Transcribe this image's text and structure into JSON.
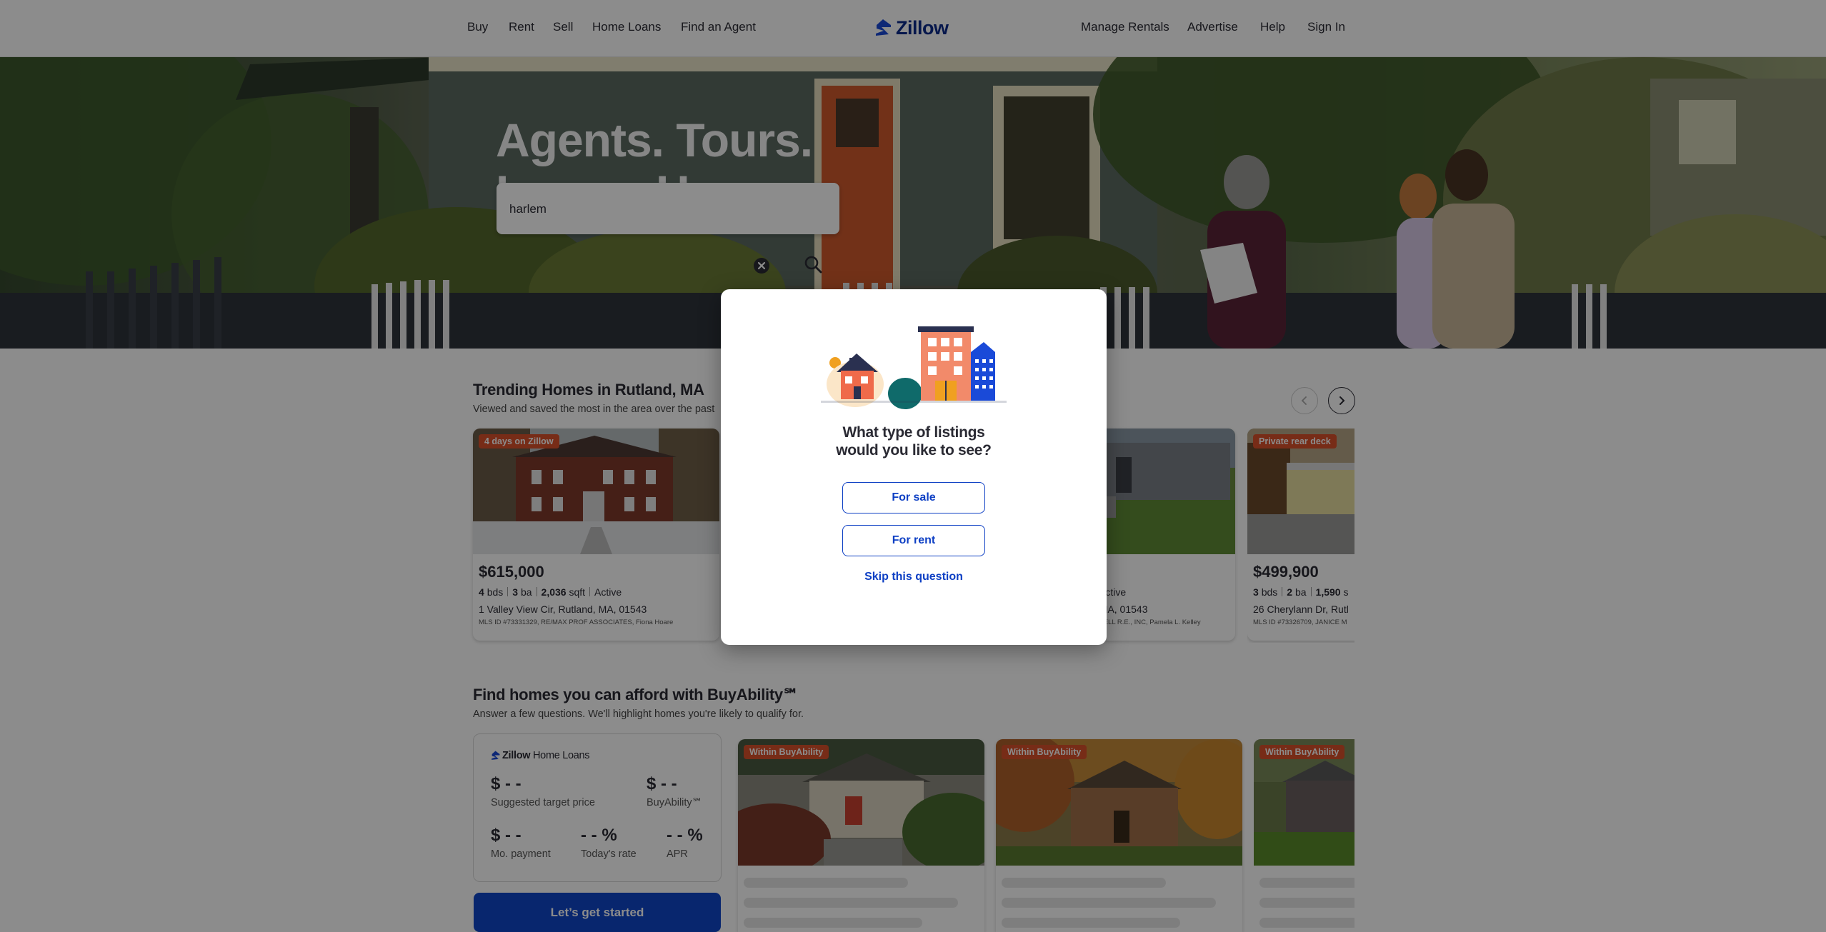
{
  "nav": {
    "left": [
      "Buy",
      "Rent",
      "Sell",
      "Home Loans",
      "Find an Agent"
    ],
    "right": [
      "Manage Rentals",
      "Advertise",
      "Help",
      "Sign In"
    ],
    "logo_text": "Zillow"
  },
  "hero": {
    "title_line1": "Agents. Tours.",
    "title_line2": "Loans. Homes.",
    "search_value": "harlem"
  },
  "trending": {
    "title": "Trending Homes in Rutland, MA",
    "subtitle": "Viewed and saved the most in the area over the past",
    "cards": [
      {
        "badge": "4 days on Zillow",
        "price": "$615,000",
        "beds": "4",
        "beds_label": "bds",
        "baths": "3",
        "baths_label": "ba",
        "sqft": "2,036",
        "sqft_label": "sqft",
        "status": "Active",
        "address": "1 Valley View Cir, Rutland, MA, 01543",
        "mls": "MLS ID #73331329, RE/MAX PROF ASSOCIATES, Fiona Hoare"
      },
      {
        "status": "Active",
        "address": ", MA, 01543",
        "mls": "CHELL R.E., INC, Pamela L. Kelley"
      },
      {
        "badge": "Private rear deck",
        "price": "$499,900",
        "beds": "3",
        "beds_label": "bds",
        "baths": "2",
        "baths_label": "ba",
        "sqft": "1,590",
        "sqft_label": "s",
        "address": "26 Cherylann Dr, Rutl",
        "mls": "MLS ID #73326709, JANICE M"
      }
    ]
  },
  "buyability": {
    "title": "Find homes you can afford with BuyAbility℠",
    "subtitle": "Answer a few questions. We'll highlight homes you're likely to qualify for.",
    "logo_text_bold": "Zillow",
    "logo_text_rest": " Home Loans",
    "target_price_value": "$ - -",
    "target_price_label": "Suggested target price",
    "buyability_value": "$ - -",
    "buyability_label": "BuyAbility℠",
    "payment_value": "$ - -",
    "payment_label": "Mo. payment",
    "rate_value": "- - %",
    "rate_label": "Today's rate",
    "apr_value": "- - %",
    "apr_label": "APR",
    "cta": "Let’s get started",
    "badges": [
      "Within BuyAbility",
      "Within BuyAbility",
      "Within BuyAbility"
    ]
  },
  "modal": {
    "question_line1": "What type of listings",
    "question_line2": "would you like to see?",
    "for_sale": "For sale",
    "for_rent": "For rent",
    "skip": "Skip this question"
  },
  "colors": {
    "brand_blue": "#0b2a8a",
    "link_blue": "#0d3fc4",
    "cta_blue": "#1045c8",
    "badge_orange": "#d9502a",
    "overlay": "rgba(0,0,0,0.45)"
  },
  "icons": [
    "zillow-logo-icon",
    "clear-icon",
    "search-icon",
    "chevron-left-icon",
    "chevron-right-icon",
    "zillow-home-loans-icon",
    "listings-illustration"
  ]
}
